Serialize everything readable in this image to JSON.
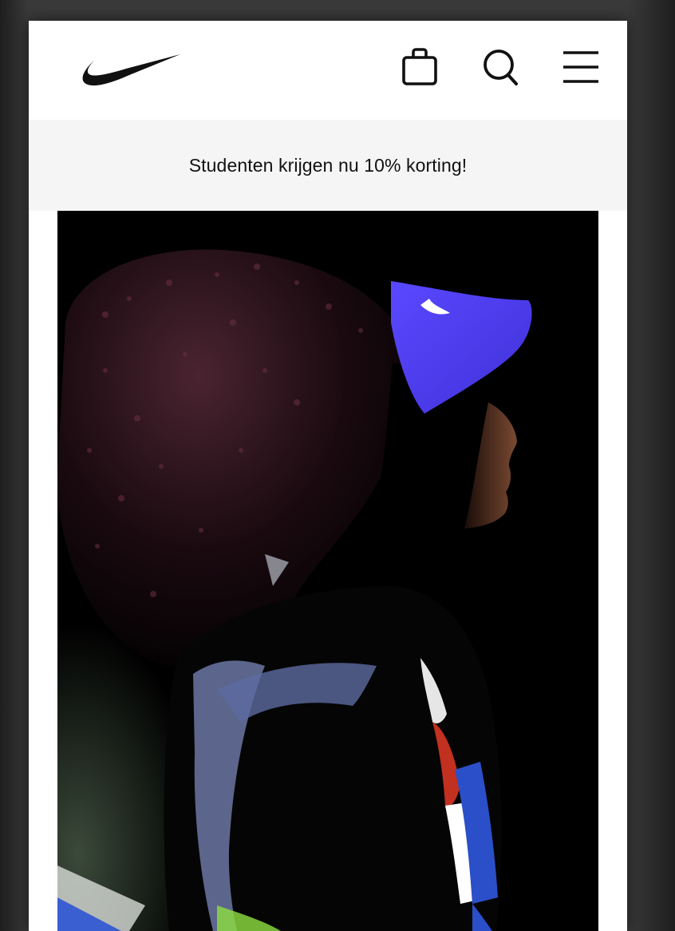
{
  "header": {
    "logo_icon": "nike-swoosh-icon",
    "bag_icon": "shopping-bag-icon",
    "search_icon": "search-icon",
    "menu_icon": "hamburger-menu-icon"
  },
  "promo": {
    "text": "Studenten krijgen nu 10% korting!"
  },
  "colors": {
    "brand": "#111111",
    "promo_background": "#f5f5f5",
    "visor_accent": "#4b3cf0"
  }
}
